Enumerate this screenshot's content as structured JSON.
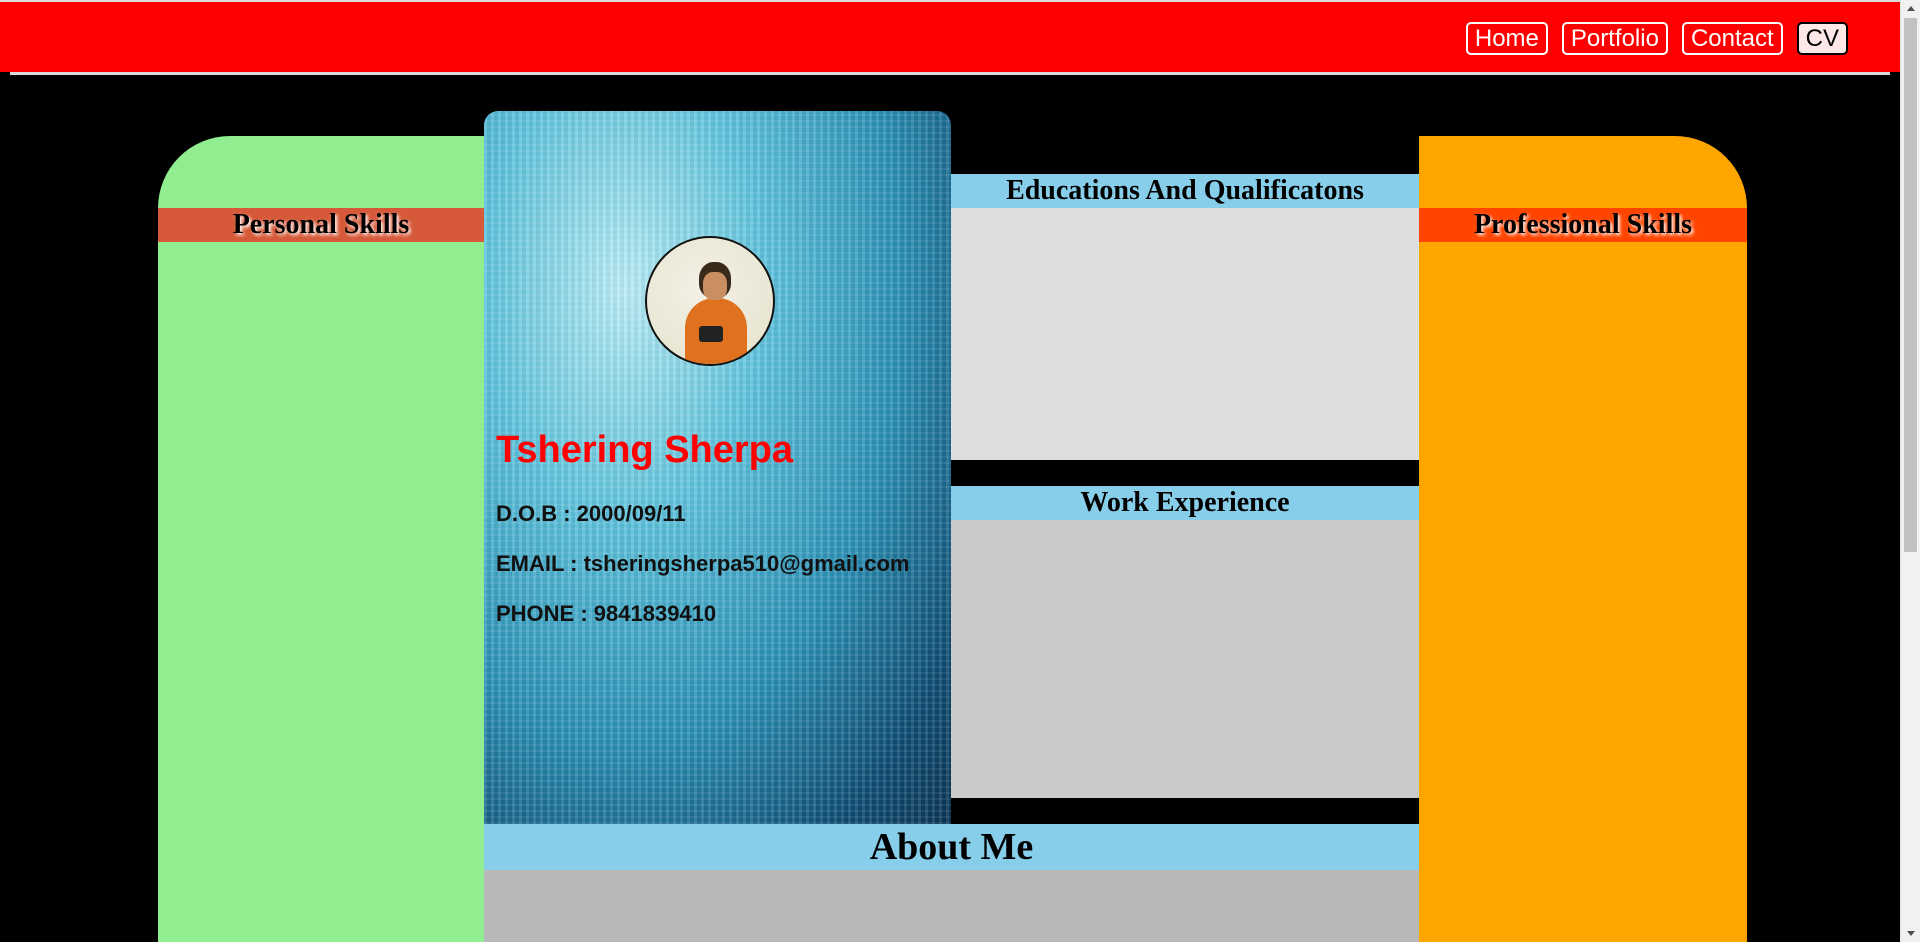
{
  "nav": {
    "items": [
      {
        "label": "Home"
      },
      {
        "label": "Portfolio"
      },
      {
        "label": "Contact"
      },
      {
        "label": "CV"
      }
    ],
    "active": "CV"
  },
  "left_column": {
    "heading": "Personal Skills"
  },
  "right_column": {
    "heading": "Professional Skills"
  },
  "profile": {
    "name": "Tshering Sherpa",
    "dob": "D.O.B : 2000/09/11",
    "email": "EMAIL : tsheringsherpa510@gmail.com",
    "phone": "PHONE : 9841839410"
  },
  "sections": {
    "education": "Educations And Qualificatons",
    "work": "Work Experience",
    "about": "About Me"
  },
  "colors": {
    "navbar": "#ff0000",
    "personal_skills_bg": "#90ee90",
    "professional_skills_bg": "#ffa500",
    "section_header_bg": "#87ceeb",
    "name_color": "#ff0000"
  }
}
